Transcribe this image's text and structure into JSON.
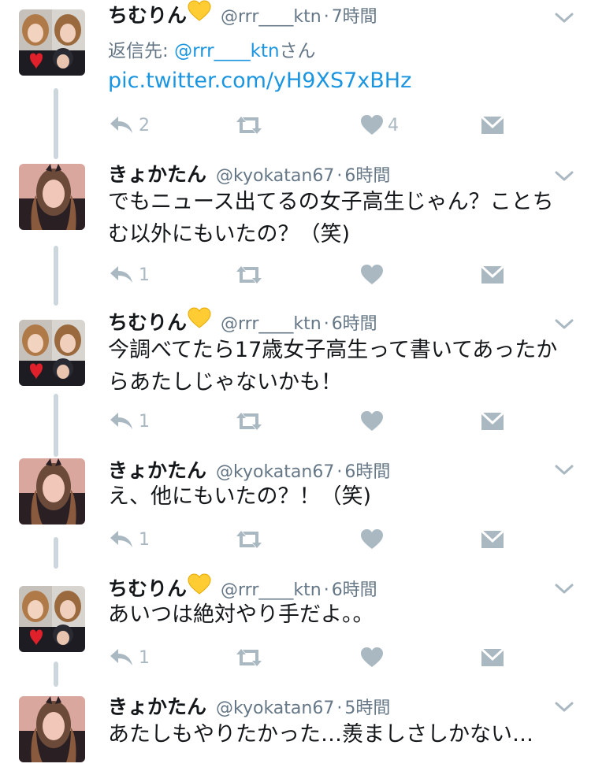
{
  "colors": {
    "link": "#1b95e0",
    "meta": "#657786",
    "action_icon": "#aab8c2",
    "thread_line": "#ccd6dd",
    "text": "#14171a"
  },
  "tweets": [
    {
      "name": "ちむりん",
      "name_emoji": "yellow-heart",
      "handle": "@rrr____ktn",
      "separator": "·",
      "time": "7時間",
      "reply_to_prefix": "返信先: ",
      "reply_to_handle": "@rrr____ktn",
      "reply_to_suffix": "さん",
      "link": "pic.twitter.com/yH9XS7xBHz",
      "reply_count": "2",
      "retweet_count": "",
      "like_count": "4"
    },
    {
      "name": "きょかたん",
      "handle": "@kyokatan67",
      "separator": "·",
      "time": "6時間",
      "text": "でもニュース出てるの女子高生じゃん？ことちむ以外にもいたの？（笑)",
      "reply_count": "1",
      "retweet_count": "",
      "like_count": ""
    },
    {
      "name": "ちむりん",
      "name_emoji": "yellow-heart",
      "handle": "@rrr____ktn",
      "separator": "·",
      "time": "6時間",
      "text": "今調べてたら17歳女子高生って書いてあったからあたしじゃないかも！",
      "reply_count": "1",
      "retweet_count": "",
      "like_count": ""
    },
    {
      "name": "きょかたん",
      "handle": "@kyokatan67",
      "separator": "·",
      "time": "6時間",
      "text": "え、他にもいたの？！（笑)",
      "reply_count": "1",
      "retweet_count": "",
      "like_count": ""
    },
    {
      "name": "ちむりん",
      "name_emoji": "yellow-heart",
      "handle": "@rrr____ktn",
      "separator": "·",
      "time": "6時間",
      "text": "あいつは絶対やり手だよ。。",
      "reply_count": "1",
      "retweet_count": "",
      "like_count": ""
    },
    {
      "name": "きょかたん",
      "handle": "@kyokatan67",
      "separator": "·",
      "time": "5時間",
      "text": "あたしもやりたかった…羨ましさしかない…"
    }
  ]
}
